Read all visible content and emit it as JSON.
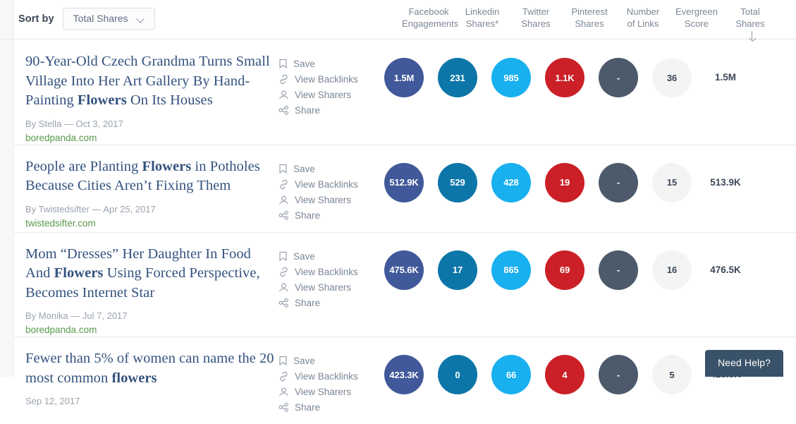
{
  "toolbar": {
    "sort_label": "Sort by",
    "sort_value": "Total Shares",
    "chevron_icon": "chevron-down-icon"
  },
  "columns": [
    {
      "line1": "Facebook",
      "line2": "Engagements"
    },
    {
      "line1": "Linkedin",
      "line2": "Shares*"
    },
    {
      "line1": "Twitter",
      "line2": "Shares"
    },
    {
      "line1": "Pinterest",
      "line2": "Shares"
    },
    {
      "line1": "Number",
      "line2": "of Links"
    },
    {
      "line1": "Evergreen",
      "line2": "Score"
    },
    {
      "line1": "Total",
      "line2": "Shares"
    }
  ],
  "sort_indicator_icon": "arrow-down-icon",
  "actions": [
    {
      "label": "Save",
      "icon": "bookmark-icon"
    },
    {
      "label": "View Backlinks",
      "icon": "link-icon"
    },
    {
      "label": "View Sharers",
      "icon": "person-icon"
    },
    {
      "label": "Share",
      "icon": "share-nodes-icon"
    }
  ],
  "colors": {
    "facebook": "#41599a",
    "linkedin": "#0d76a8",
    "twitter": "#18b0ef",
    "pinterest": "#cb2027",
    "links": "#4d5a6b",
    "evergreen": "#f4f4f5",
    "title": "#33527e",
    "domain": "#5b9a4e",
    "need_help": "#3a5269"
  },
  "rows": [
    {
      "title_html": "90-Year-Old Czech Grandma Turns Small Village Into Her Art Gallery By Hand-Painting <b>Flowers</b> On Its Houses",
      "byline": "By Stella — Oct 3, 2017",
      "domain": "boredpanda.com",
      "facebook": "1.5M",
      "linkedin": "231",
      "twitter": "985",
      "pinterest": "1.1K",
      "links": "-",
      "evergreen": "36",
      "total": "1.5M"
    },
    {
      "title_html": "People are Planting <b>Flowers</b> in Potholes Because Cities Aren’t Fixing Them",
      "byline": "By Twistedsifter — Apr 25, 2017",
      "domain": "twistedsifter.com",
      "facebook": "512.9K",
      "linkedin": "529",
      "twitter": "428",
      "pinterest": "19",
      "links": "-",
      "evergreen": "15",
      "total": "513.9K"
    },
    {
      "title_html": "Mom “Dresses” Her Daughter In Food And <b>Flowers</b> Using Forced Perspective, Becomes Internet Star",
      "byline": "By Monika — Jul 7, 2017",
      "domain": "boredpanda.com",
      "facebook": "475.6K",
      "linkedin": "17",
      "twitter": "865",
      "pinterest": "69",
      "links": "-",
      "evergreen": "16",
      "total": "476.5K"
    },
    {
      "title_html": "Fewer than 5% of women can name the 20 most common <b>flowers</b>",
      "byline": "Sep 12, 2017",
      "domain": "",
      "facebook": "423.3K",
      "linkedin": "0",
      "twitter": "66",
      "pinterest": "4",
      "links": "-",
      "evergreen": "5",
      "total": "423.3K"
    }
  ],
  "help_widget": {
    "label": "Need Help?"
  }
}
